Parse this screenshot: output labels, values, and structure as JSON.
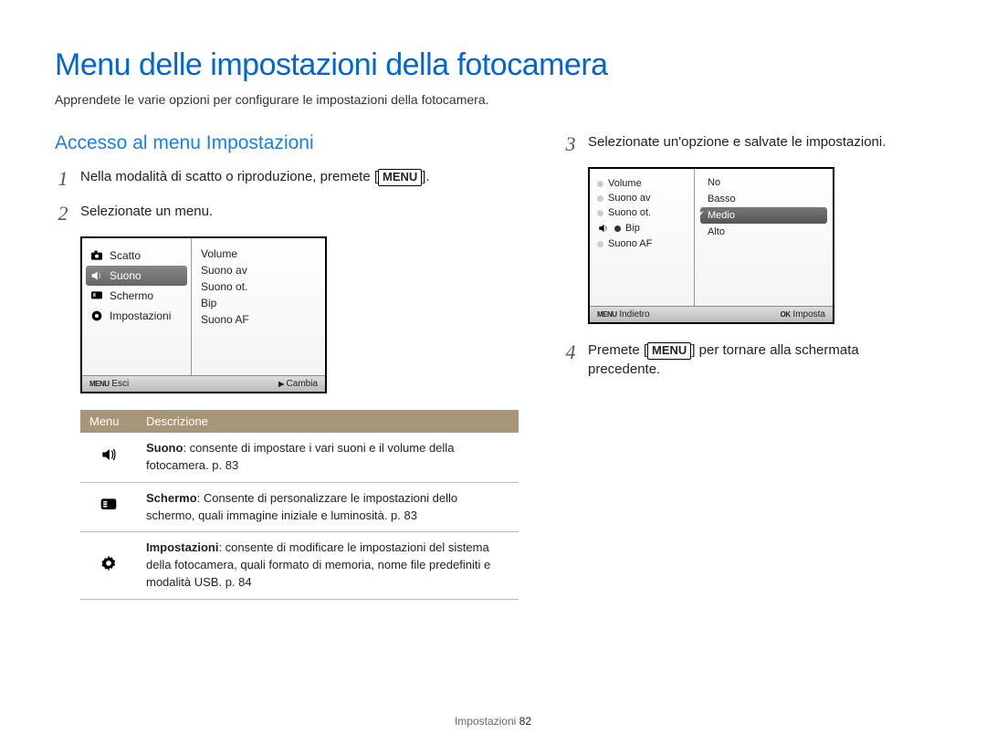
{
  "page_title": "Menu delle impostazioni della fotocamera",
  "subtitle": "Apprendete le varie opzioni per configurare le impostazioni della fotocamera.",
  "section_heading": "Accesso al menu Impostazioni",
  "steps_left": {
    "s1_pre": "Nella modalità di scatto o riproduzione, premete [",
    "s1_btn": "MENU",
    "s1_post": "].",
    "s2": "Selezionate un menu."
  },
  "screen1": {
    "left": [
      "Scatto",
      "Suono",
      "Schermo",
      "Impostazioni"
    ],
    "selected_left_index": 1,
    "right": [
      "Volume",
      "Suono av",
      "Suono ot.",
      "Bip",
      "Suono AF"
    ],
    "footer_left_label": "Esci",
    "footer_left_key": "MENU",
    "footer_right_label": "Cambia",
    "footer_right_key": "▶"
  },
  "table": {
    "head_menu": "Menu",
    "head_desc": "Descrizione",
    "rows": [
      {
        "icon": "speaker-icon",
        "title": "Suono",
        "text": ": consente di impostare i vari suoni e il volume della fotocamera. p. 83"
      },
      {
        "icon": "screen-icon",
        "title": "Schermo",
        "text": ": Consente di personalizzare le impostazioni dello schermo, quali immagine iniziale e luminosità. p. 83"
      },
      {
        "icon": "gear-icon",
        "title": "Impostazioni",
        "text": ": consente di modificare le impostazioni del sistema della fotocamera, quali formato di memoria, nome file predefiniti e modalità USB. p. 84"
      }
    ]
  },
  "steps_right": {
    "s3": "Selezionate un'opzione e salvate le impostazioni.",
    "s4_pre": "Premete [",
    "s4_btn": "MENU",
    "s4_post": "] per tornare alla schermata precedente."
  },
  "screen2": {
    "left": [
      "Volume",
      "Suono av",
      "Suono ot.",
      "Bip",
      "Suono AF"
    ],
    "selected_left_index": 3,
    "right": [
      "No",
      "Basso",
      "Medio",
      "Alto"
    ],
    "selected_right_index": 2,
    "footer_left_label": "Indietro",
    "footer_left_key": "MENU",
    "footer_right_label": "Imposta",
    "footer_right_key": "OK"
  },
  "footer_section": "Impostazioni",
  "footer_page": "82"
}
